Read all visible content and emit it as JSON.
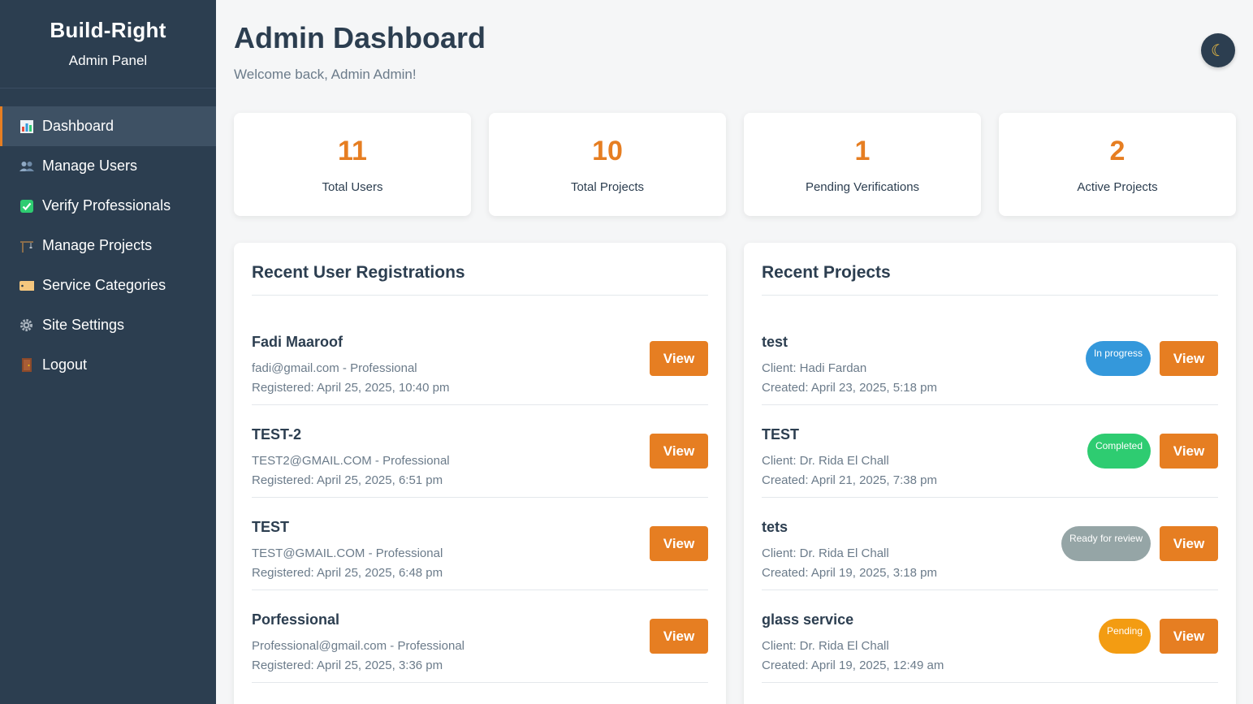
{
  "sidebar": {
    "title": "Build-Right",
    "subtitle": "Admin Panel",
    "items": [
      {
        "label": "Dashboard",
        "icon": "bar-chart-icon",
        "active": true
      },
      {
        "label": "Manage Users",
        "icon": "users-icon"
      },
      {
        "label": "Verify Professionals",
        "icon": "check-icon"
      },
      {
        "label": "Manage Projects",
        "icon": "crane-icon"
      },
      {
        "label": "Service Categories",
        "icon": "tag-icon"
      },
      {
        "label": "Site Settings",
        "icon": "gear-icon"
      },
      {
        "label": "Logout",
        "icon": "door-icon"
      }
    ]
  },
  "header": {
    "title": "Admin Dashboard",
    "welcome": "Welcome back, Admin Admin!",
    "theme_icon": "moon-icon"
  },
  "stats": [
    {
      "value": "11",
      "label": "Total Users"
    },
    {
      "value": "10",
      "label": "Total Projects"
    },
    {
      "value": "1",
      "label": "Pending Verifications"
    },
    {
      "value": "2",
      "label": "Active Projects"
    }
  ],
  "recent_users": {
    "title": "Recent User Registrations",
    "rows": [
      {
        "name": "Fadi Maaroof",
        "line1": "fadi@gmail.com - Professional",
        "line2": "Registered: April 25, 2025, 10:40 pm",
        "button": "View"
      },
      {
        "name": "TEST-2",
        "line1": "TEST2@GMAIL.COM - Professional",
        "line2": "Registered: April 25, 2025, 6:51 pm",
        "button": "View"
      },
      {
        "name": "TEST",
        "line1": "TEST@GMAIL.COM - Professional",
        "line2": "Registered: April 25, 2025, 6:48 pm",
        "button": "View"
      },
      {
        "name": "Porfessional",
        "line1": "Professional@gmail.com - Professional",
        "line2": "Registered: April 25, 2025, 3:36 pm",
        "button": "View"
      }
    ]
  },
  "recent_projects": {
    "title": "Recent Projects",
    "rows": [
      {
        "name": "test",
        "line1": "Client: Hadi Fardan",
        "line2": "Created: April 23, 2025, 5:18 pm",
        "status": "In progress",
        "status_color": "#3498db",
        "button": "View"
      },
      {
        "name": "TEST",
        "line1": "Client: Dr. Rida El Chall",
        "line2": "Created: April 21, 2025, 7:38 pm",
        "status": "Completed",
        "status_color": "#2ecc71",
        "button": "View"
      },
      {
        "name": "tets",
        "line1": "Client: Dr. Rida El Chall",
        "line2": "Created: April 19, 2025, 3:18 pm",
        "status": "Ready for review",
        "status_color": "#95a5a6",
        "button": "View"
      },
      {
        "name": "glass service",
        "line1": "Client: Dr. Rida El Chall",
        "line2": "Created: April 19, 2025, 12:49 am",
        "status": "Pending",
        "status_color": "#f39c12",
        "button": "View"
      }
    ]
  },
  "colors": {
    "accent": "#e67e22",
    "sidebar_bg": "#2c3e50"
  }
}
